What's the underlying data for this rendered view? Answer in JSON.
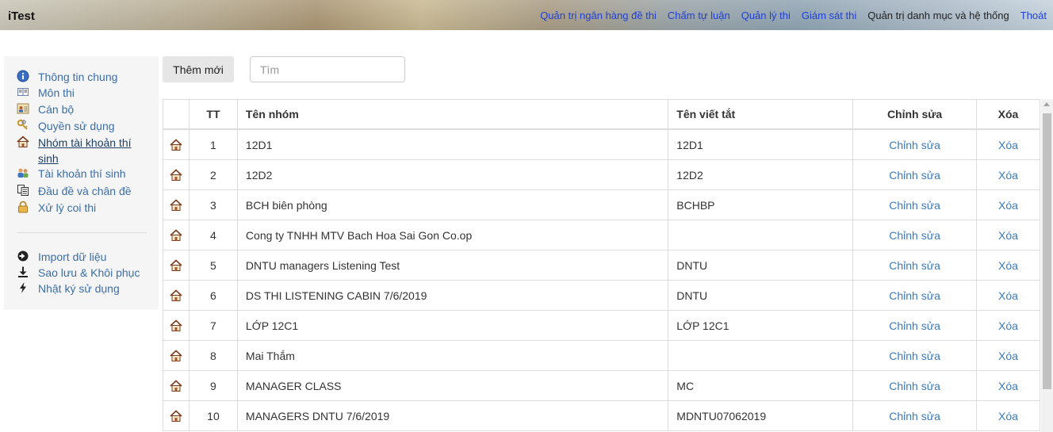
{
  "app": {
    "brand": "iTest"
  },
  "topnav": [
    {
      "label": "Quản trị ngân hàng đề thi",
      "active": false
    },
    {
      "label": "Chấm tự luận",
      "active": false
    },
    {
      "label": "Quản lý thi",
      "active": false
    },
    {
      "label": "Giám sát thi",
      "active": false
    },
    {
      "label": "Quản trị danh mục và hệ thống",
      "active": true
    },
    {
      "label": "Thoát",
      "active": false
    }
  ],
  "sidebar": {
    "items": [
      {
        "label": "Thông tin chung",
        "icon": "info-icon"
      },
      {
        "label": "Môn thi",
        "icon": "book-icon"
      },
      {
        "label": "Cán bộ",
        "icon": "id-card-icon"
      },
      {
        "label": "Quyền sử dụng",
        "icon": "keys-icon"
      },
      {
        "label": "Nhóm tài khoản thí sinh",
        "icon": "house-icon",
        "current": true
      },
      {
        "label": "Tài khoản thí sinh",
        "icon": "users-icon"
      },
      {
        "label": "Đầu đề và chân đề",
        "icon": "copy-icon"
      },
      {
        "label": "Xử lý coi thi",
        "icon": "lock-icon"
      }
    ],
    "tools": [
      {
        "label": "Import dữ liệu",
        "icon": "arrow-circle-right-icon"
      },
      {
        "label": "Sao lưu & Khôi phục",
        "icon": "download-icon"
      },
      {
        "label": "Nhật ký sử dụng",
        "icon": "bolt-icon"
      }
    ]
  },
  "toolbar": {
    "add_label": "Thêm mới",
    "search_placeholder": "Tìm"
  },
  "table": {
    "headers": {
      "tt": "TT",
      "name": "Tên nhóm",
      "abbr": "Tên viết tắt",
      "edit": "Chỉnh sửa",
      "delete": "Xóa"
    },
    "edit_label": "Chỉnh sửa",
    "delete_label": "Xóa",
    "rows": [
      {
        "tt": "1",
        "name": "12D1",
        "abbr": "12D1"
      },
      {
        "tt": "2",
        "name": "12D2",
        "abbr": "12D2"
      },
      {
        "tt": "3",
        "name": "BCH biên phòng",
        "abbr": "BCHBP"
      },
      {
        "tt": "4",
        "name": "Cong ty TNHH MTV Bach Hoa Sai Gon Co.op",
        "abbr": ""
      },
      {
        "tt": "5",
        "name": "DNTU managers Listening Test",
        "abbr": "DNTU"
      },
      {
        "tt": "6",
        "name": "DS THI LISTENING CABIN 7/6/2019",
        "abbr": "DNTU"
      },
      {
        "tt": "7",
        "name": "LỚP 12C1",
        "abbr": "LỚP 12C1"
      },
      {
        "tt": "8",
        "name": "Mai Thắm",
        "abbr": ""
      },
      {
        "tt": "9",
        "name": "MANAGER CLASS",
        "abbr": "MC"
      },
      {
        "tt": "10",
        "name": "MANAGERS DNTU 7/6/2019",
        "abbr": "MDNTU07062019"
      }
    ]
  }
}
